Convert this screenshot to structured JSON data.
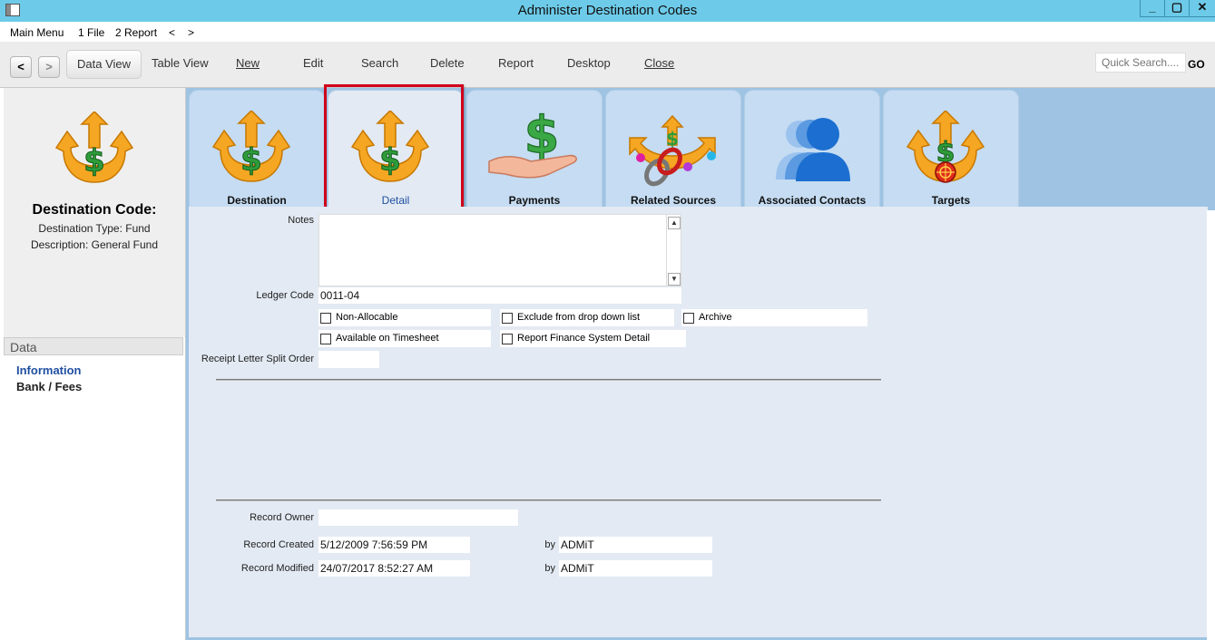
{
  "window": {
    "title": "Administer Destination Codes",
    "minimize": "_",
    "maximize": "▢",
    "close": "✕"
  },
  "menu": [
    "Main Menu",
    "1 File",
    "2 Report",
    "<",
    ">"
  ],
  "toolbar": {
    "back": "<",
    "forward": ">",
    "buttons": [
      "Data View",
      "Table View",
      "New",
      "Edit",
      "Search",
      "Delete",
      "Report",
      "Desktop",
      "Close"
    ],
    "quick_search_placeholder": "Quick Search....",
    "go": "GO"
  },
  "left": {
    "title": "Destination Code:",
    "line1": "Destination Type: Fund",
    "line2": "Description: General Fund",
    "data_header": "Data",
    "links": [
      "Information",
      "Bank / Fees"
    ]
  },
  "tabs": [
    {
      "label": "Destination",
      "icon": "dollar-arrows-icon"
    },
    {
      "label": "Detail",
      "icon": "dollar-arrows-icon"
    },
    {
      "label": "Payments",
      "icon": "dollar-hand-icon"
    },
    {
      "label": "Related Sources",
      "icon": "dollar-chain-icon"
    },
    {
      "label": "Associated Contacts",
      "icon": "people-icon"
    },
    {
      "label": "Targets",
      "icon": "dollar-target-icon"
    }
  ],
  "selected_tab": "Detail",
  "form": {
    "notes_label": "Notes",
    "notes_value": "",
    "ledger_label": "Ledger Code",
    "ledger_value": "0011-04",
    "checkboxes": [
      "Non-Allocable",
      "Exclude from drop down list",
      "Archive",
      "Available on Timesheet",
      "Report Finance System Detail"
    ],
    "receipt_label": "Receipt Letter Split Order",
    "receipt_value": "",
    "record_owner_label": "Record Owner",
    "record_owner_value": "",
    "created_label": "Record Created",
    "created_value": "5/12/2009 7:56:59 PM",
    "created_by_label": "by",
    "created_by_value": "ADMiT",
    "modified_label": "Record Modified",
    "modified_value": "24/07/2017 8:52:27 AM",
    "modified_by_label": "by",
    "modified_by_value": "ADMiT"
  },
  "colors": {
    "titlebar": "#6dcbe9",
    "tab_bg": "#c5dcf2",
    "highlight": "#d0021b"
  }
}
